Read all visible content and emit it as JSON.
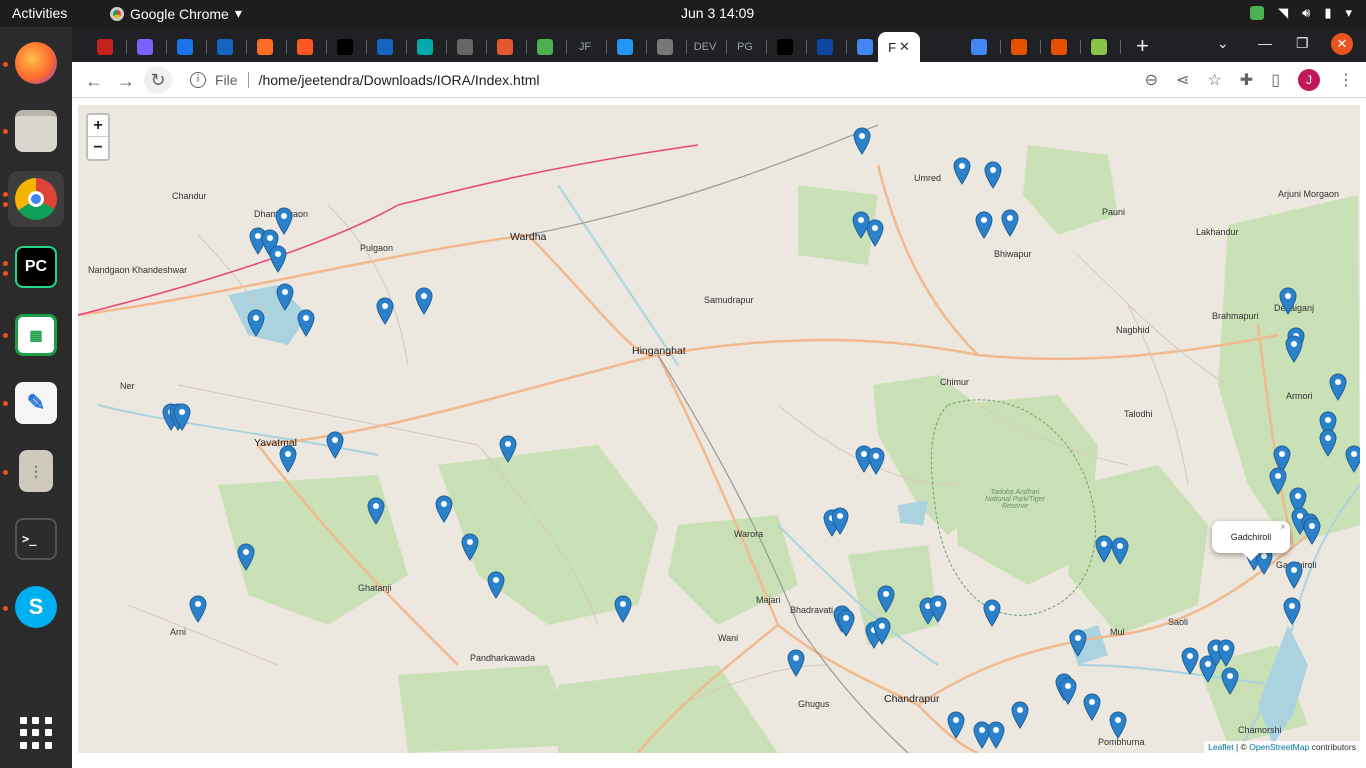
{
  "topbar": {
    "activities": "Activities",
    "app_name": "Google Chrome",
    "clock": "Jun 3  14:09"
  },
  "dock": {
    "items": [
      "Firefox",
      "Files",
      "Google Chrome",
      "PyCharm",
      "LibreOffice Calc",
      "Text Editor",
      "Archive",
      "Terminal",
      "Skype"
    ]
  },
  "browser": {
    "active_tab_title": "F",
    "tab_snippets": [
      "",
      "",
      "",
      "",
      "",
      "",
      "",
      "",
      "",
      "",
      "",
      "",
      "JF",
      "",
      "",
      "DEV",
      "PG",
      "",
      "",
      "",
      "",
      "",
      ""
    ],
    "url_scheme": "File",
    "url": "/home/jeetendra/Downloads/IORA/Index.html",
    "avatar_letter": "J"
  },
  "map": {
    "zoom_in": "+",
    "zoom_out": "−",
    "popup_text": "Gadchiroli",
    "popup_close": "×",
    "attribution_leaflet": "Leaflet",
    "attribution_osm": "OpenStreetMap",
    "attribution_suffix": " contributors",
    "attribution_sep": " | © ",
    "places": [
      {
        "name": "Wardha",
        "cls": "big"
      },
      {
        "name": "Hinganghat",
        "cls": "big"
      },
      {
        "name": "Yavatmal",
        "cls": "big"
      },
      {
        "name": "Chandrapur",
        "cls": "big"
      },
      {
        "name": "Gadchiroli",
        "cls": ""
      },
      {
        "name": "Dhamangaon",
        "cls": ""
      },
      {
        "name": "Pulgaon",
        "cls": ""
      },
      {
        "name": "Samudrapur",
        "cls": ""
      },
      {
        "name": "Umred",
        "cls": ""
      },
      {
        "name": "Bhiwapur",
        "cls": ""
      },
      {
        "name": "Pauni",
        "cls": ""
      },
      {
        "name": "Lakhandur",
        "cls": ""
      },
      {
        "name": "Arjuni Morgaon",
        "cls": ""
      },
      {
        "name": "Brahmapuri",
        "cls": ""
      },
      {
        "name": "Nagbhid",
        "cls": ""
      },
      {
        "name": "Chimur",
        "cls": ""
      },
      {
        "name": "Talodhi",
        "cls": ""
      },
      {
        "name": "Armori",
        "cls": ""
      },
      {
        "name": "Desaiganj",
        "cls": ""
      },
      {
        "name": "Warora",
        "cls": ""
      },
      {
        "name": "Bhadravati",
        "cls": ""
      },
      {
        "name": "Majari",
        "cls": ""
      },
      {
        "name": "Ghugus",
        "cls": ""
      },
      {
        "name": "Mul",
        "cls": ""
      },
      {
        "name": "Saoli",
        "cls": ""
      },
      {
        "name": "Wani",
        "cls": ""
      },
      {
        "name": "Ghatanji",
        "cls": ""
      },
      {
        "name": "Pandharkawada",
        "cls": ""
      },
      {
        "name": "Arni",
        "cls": ""
      },
      {
        "name": "Ner",
        "cls": ""
      },
      {
        "name": "Chandur",
        "cls": ""
      },
      {
        "name": "Nandgaon Khandeshwar",
        "cls": ""
      },
      {
        "name": "Tadoba Andhari National Park/Tiger Reserve",
        "cls": "italic"
      },
      {
        "name": "Pombhurna",
        "cls": ""
      },
      {
        "name": "Chamorshi",
        "cls": ""
      }
    ]
  },
  "colors": {
    "marker": "#2b82cb",
    "marker_dark": "#1f5f99",
    "forest": "#c8e0b4",
    "water": "#aad3df",
    "road_major": "#f2b98f",
    "rail": "#e8467c"
  }
}
